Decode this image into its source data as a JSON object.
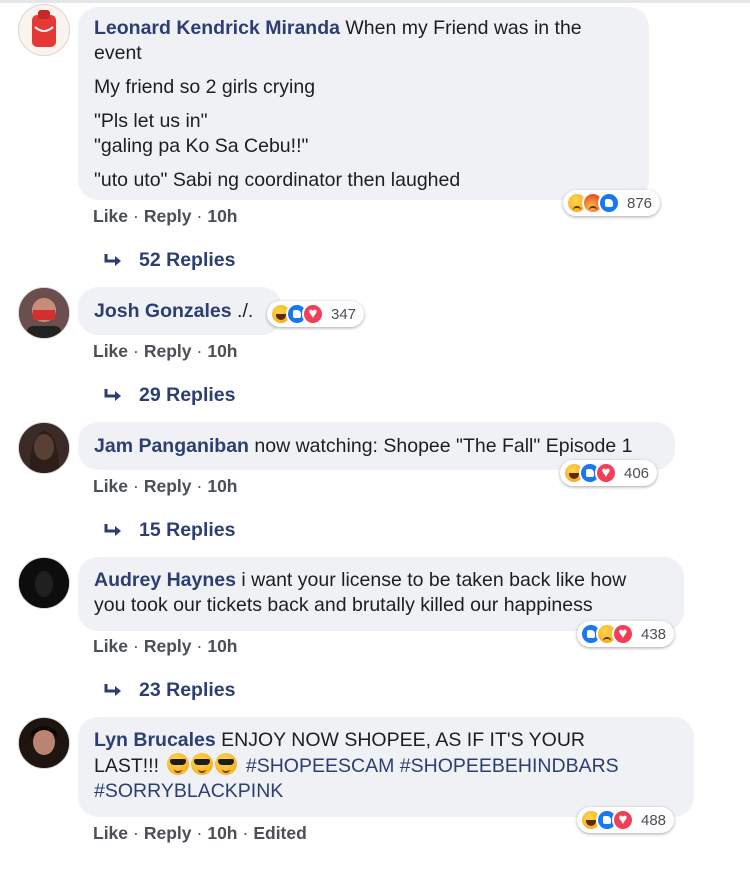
{
  "colors": {
    "author": "#2c3e72",
    "bubble": "#eff1f4",
    "meta": "#4b4f56",
    "like": "#1877f2",
    "love": "#f33e58",
    "emoji_yellow": "#ffd54a"
  },
  "comments": [
    {
      "author": "Leonard Kendrick Miranda",
      "text_lines": [
        "When my Friend was in the event",
        "My friend so 2 girls crying",
        "\"Pls let us in\"",
        "\"galing pa Ko Sa Cebu!!\"",
        "\"uto uto\" Sabi ng coordinator then laughed"
      ],
      "actions": {
        "like": "Like",
        "reply": "Reply",
        "time": "10h"
      },
      "reactions": {
        "icons": [
          "sad-icon",
          "angry-icon",
          "like-icon"
        ],
        "count": "876"
      },
      "replies_label": "52 Replies"
    },
    {
      "author": "Josh Gonzales",
      "text": "./.",
      "actions": {
        "like": "Like",
        "reply": "Reply",
        "time": "10h"
      },
      "reactions": {
        "icons": [
          "haha-icon",
          "like-icon",
          "love-icon"
        ],
        "count": "347"
      },
      "replies_label": "29 Replies"
    },
    {
      "author": "Jam Panganiban",
      "text": "now watching: Shopee \"The Fall\" Episode 1",
      "actions": {
        "like": "Like",
        "reply": "Reply",
        "time": "10h"
      },
      "reactions": {
        "icons": [
          "haha-icon",
          "like-icon",
          "love-icon"
        ],
        "count": "406"
      },
      "replies_label": "15 Replies"
    },
    {
      "author": "Audrey Haynes",
      "text_line1": "i want your license to be taken back like how",
      "text_line2": "you took our tickets back and brutally killed our happiness",
      "actions": {
        "like": "Like",
        "reply": "Reply",
        "time": "10h"
      },
      "reactions": {
        "icons": [
          "like-icon",
          "sad-icon",
          "love-icon"
        ],
        "count": "438"
      },
      "replies_label": "23 Replies"
    },
    {
      "author": "Lyn Brucales",
      "text_line1": "ENJOY NOW SHOPEE, AS IF IT'S YOUR",
      "text_line2_prefix": "LAST!!!",
      "emojis": [
        "cool-sunglasses-icon",
        "cool-sunglasses-icon",
        "cool-sunglasses-icon"
      ],
      "hashtag1": "#SHOPEESCAM",
      "hashtag2": "#SHOPEEBEHINDBARS",
      "hashtag3": "#SORRYBLACKPINK",
      "actions": {
        "like": "Like",
        "reply": "Reply",
        "time": "10h",
        "edited": "Edited"
      },
      "reactions": {
        "icons": [
          "haha-icon",
          "like-icon",
          "love-icon"
        ],
        "count": "488"
      }
    }
  ]
}
